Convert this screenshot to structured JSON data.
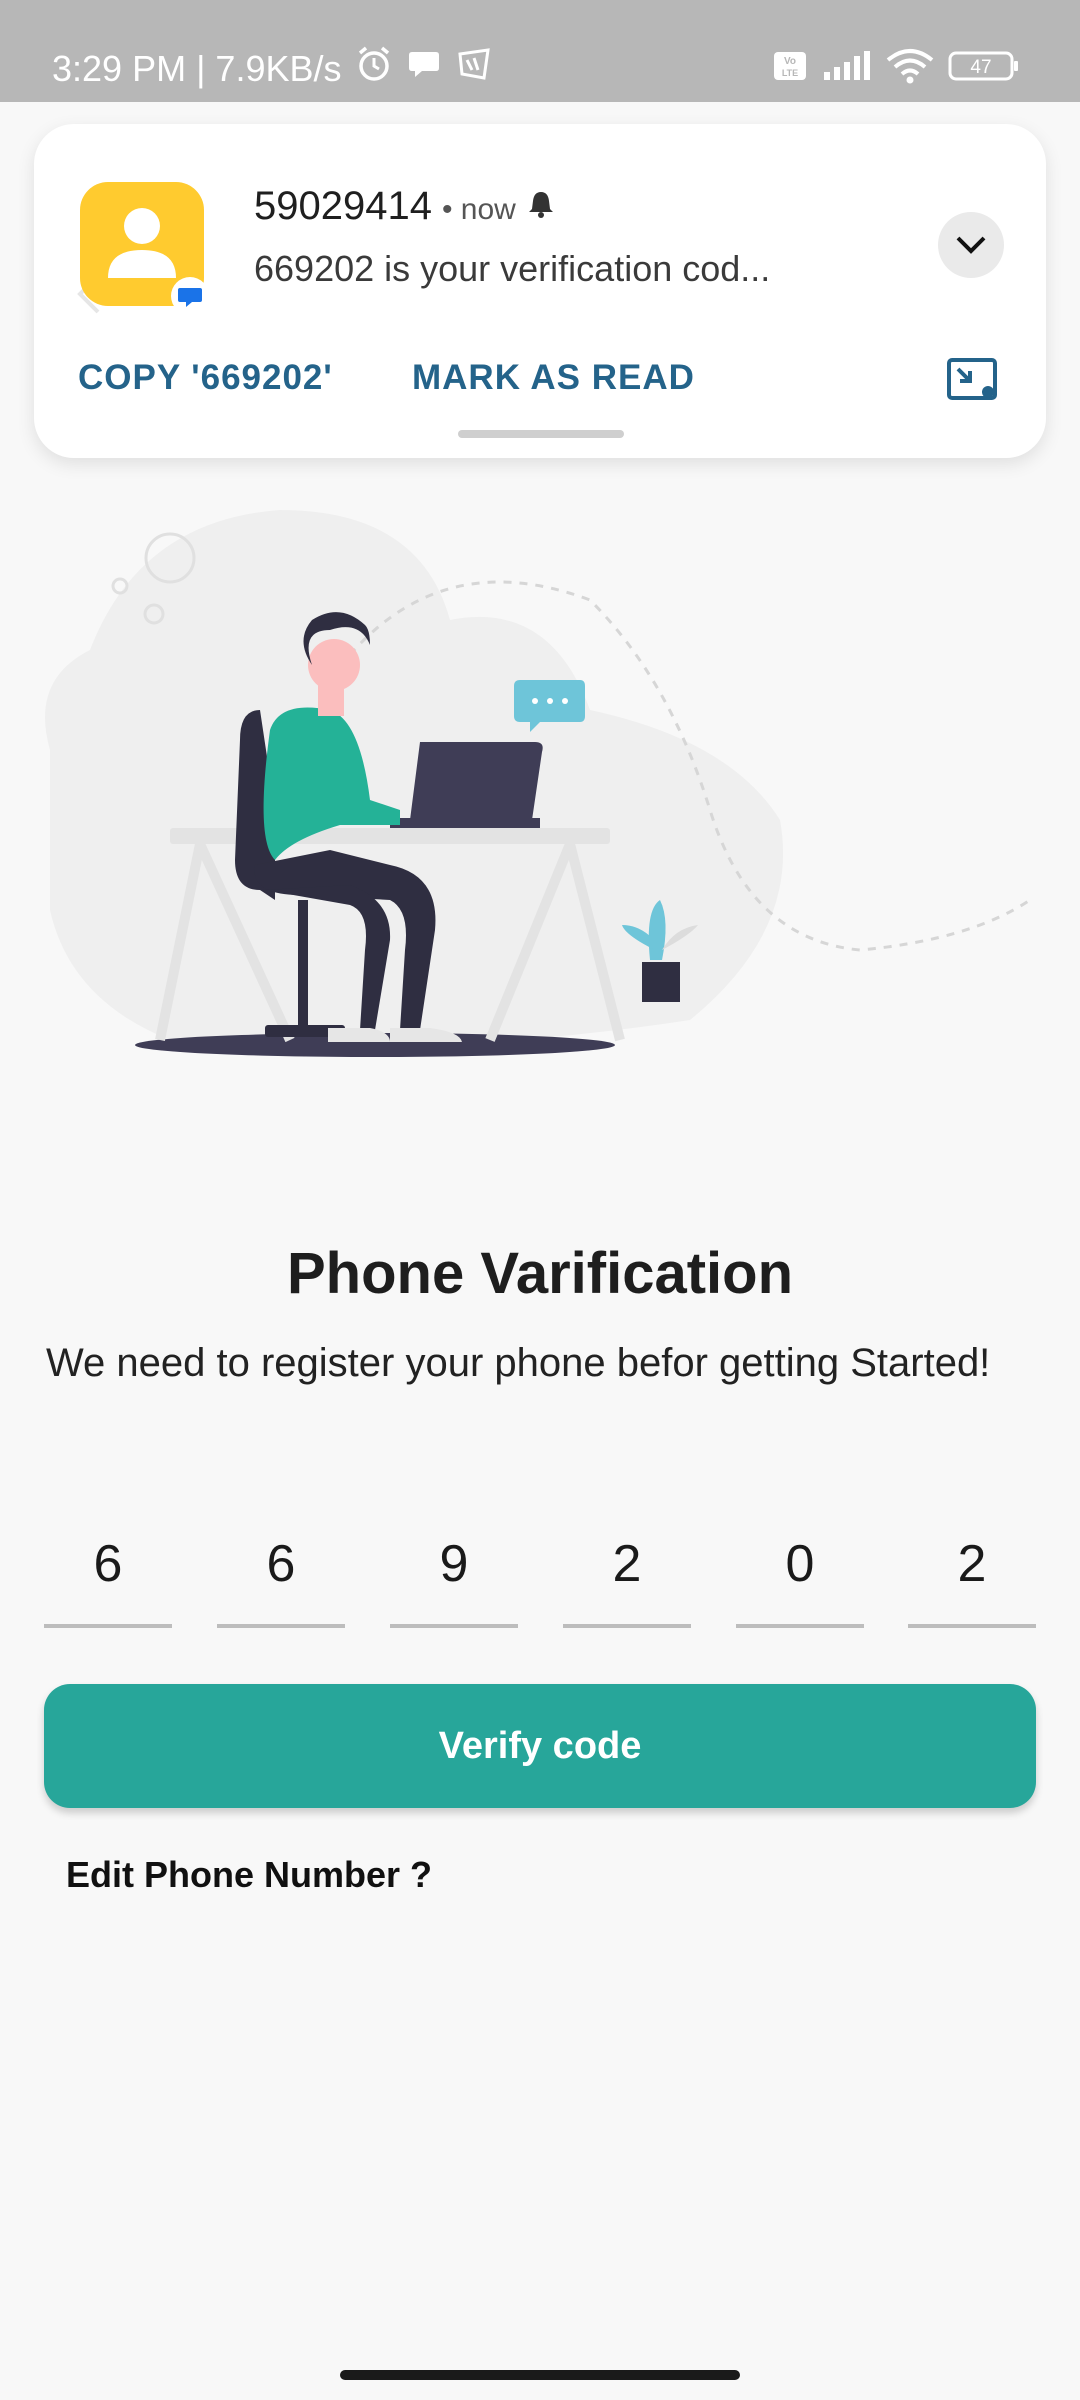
{
  "status_bar": {
    "time": "3:29 PM | 7.9KB/s",
    "icons": [
      "alarm-icon",
      "chat-bubble-icon",
      "app-badge-icon",
      "volte-icon",
      "signal-icon",
      "wifi-icon",
      "battery-icon"
    ],
    "battery": "47"
  },
  "notification": {
    "sender": "59029414",
    "time": "• now",
    "message": "669202 is your verification cod...",
    "actions": {
      "copy": "COPY '669202'",
      "mark_read": "MARK AS READ"
    },
    "colors": {
      "avatar_bg": "#ffcb2f",
      "action_text": "#24638a",
      "badge": "#1a73e8"
    }
  },
  "page": {
    "title": "Phone Varification",
    "subtitle": "We need to register your phone befor getting Started!",
    "otp_digits": [
      "6",
      "6",
      "9",
      "2",
      "0",
      "2"
    ],
    "verify_button": "Verify code",
    "edit_link": "Edit Phone Number ?"
  },
  "colors": {
    "accent": "#27a69a",
    "background": "#f8f8f8"
  }
}
